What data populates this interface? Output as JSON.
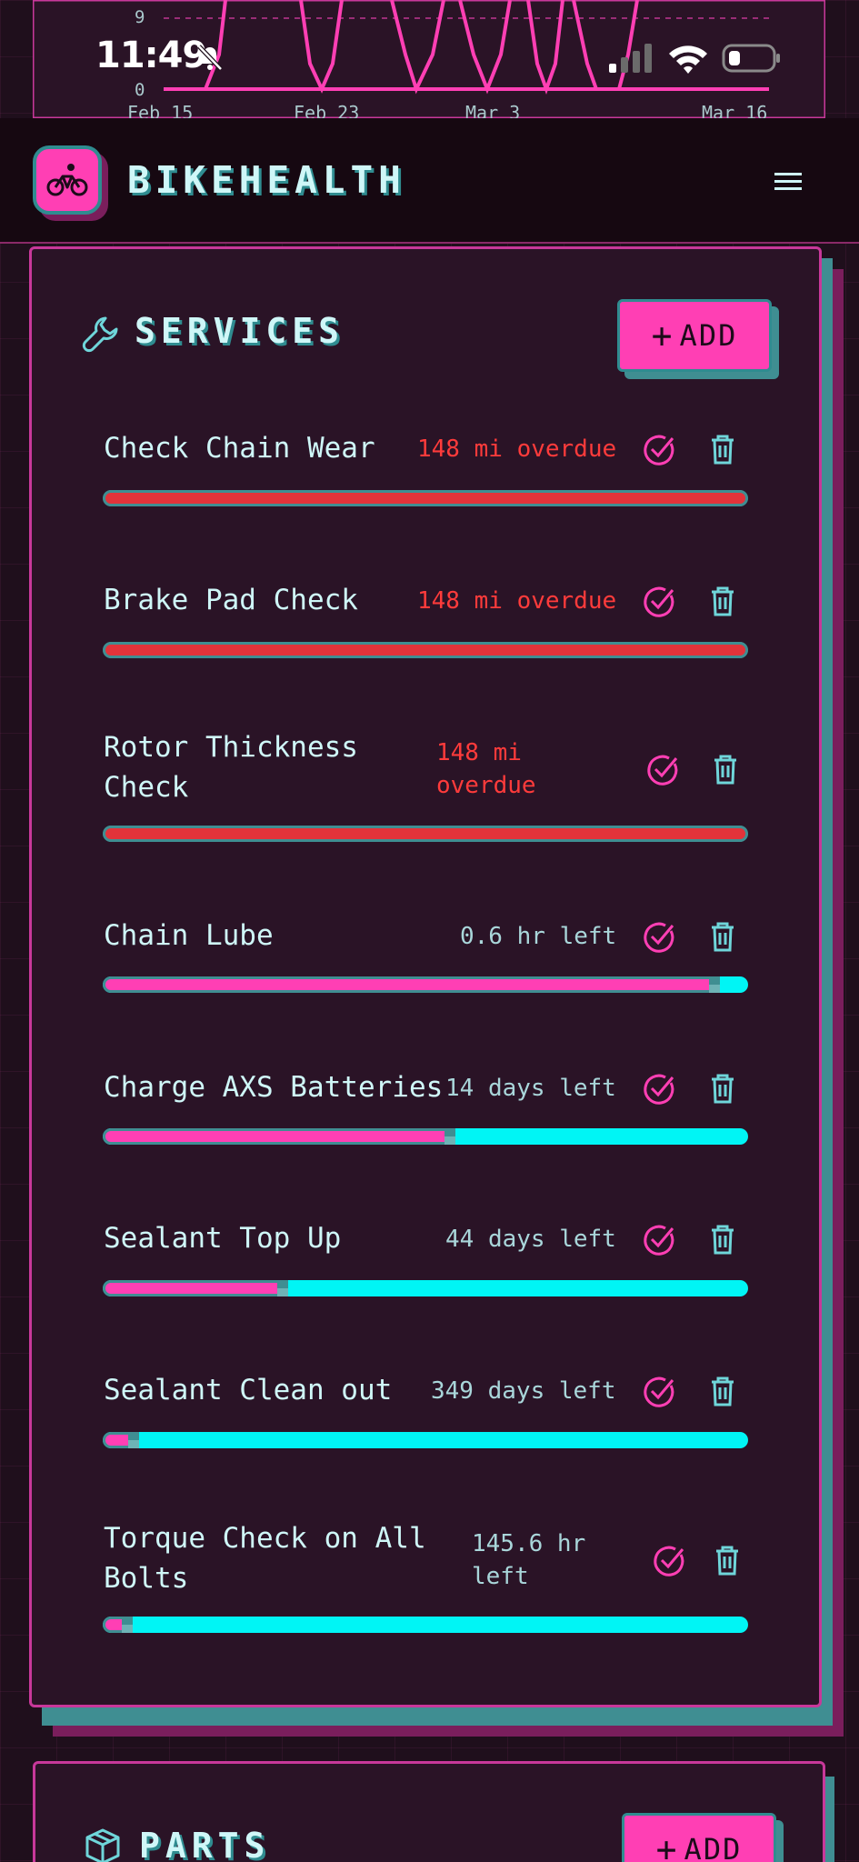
{
  "status_bar": {
    "time": "11:49"
  },
  "chart": {
    "y_ticks": [
      "9",
      "0"
    ],
    "x_ticks": [
      "Feb 15",
      "Feb 23",
      "Mar 3",
      "Mar 16"
    ]
  },
  "app": {
    "name": "BIKEHEALTH"
  },
  "services": {
    "title": "SERVICES",
    "add_label": "ADD",
    "items": [
      {
        "name": "Check Chain Wear",
        "status": "148 mi overdue",
        "state": "overdue",
        "progress": 1.0
      },
      {
        "name": "Brake Pad Check",
        "status": "148 mi overdue",
        "state": "overdue",
        "progress": 1.0
      },
      {
        "name": "Rotor Thickness Check",
        "status": "148 mi overdue",
        "state": "overdue",
        "progress": 1.0
      },
      {
        "name": "Chain Lube",
        "status": "0.6 hr left",
        "state": "ok",
        "progress": 0.94
      },
      {
        "name": "Charge AXS Batteries",
        "status": "14 days left",
        "state": "ok",
        "progress": 0.53
      },
      {
        "name": "Sealant Top Up",
        "status": "44 days left",
        "state": "ok",
        "progress": 0.27
      },
      {
        "name": "Sealant Clean out",
        "status": "349 days left",
        "state": "ok",
        "progress": 0.04
      },
      {
        "name": "Torque Check on All Bolts",
        "status": "145.6 hr left",
        "state": "ok",
        "progress": 0.03
      }
    ]
  },
  "parts": {
    "title": "PARTS",
    "add_label": "ADD"
  },
  "colors": {
    "accent_pink": "#ff3fb4",
    "accent_cyan": "#00f5f5",
    "teal_shadow": "#3f8e92",
    "overdue_red": "#ff3b3b",
    "background": "#1f0f1c"
  },
  "icons": {
    "logo": "bicycle-icon",
    "menu": "hamburger-menu-icon",
    "services": "wrench-icon",
    "parts": "box-icon",
    "complete": "check-circle-icon",
    "delete": "trash-icon"
  }
}
